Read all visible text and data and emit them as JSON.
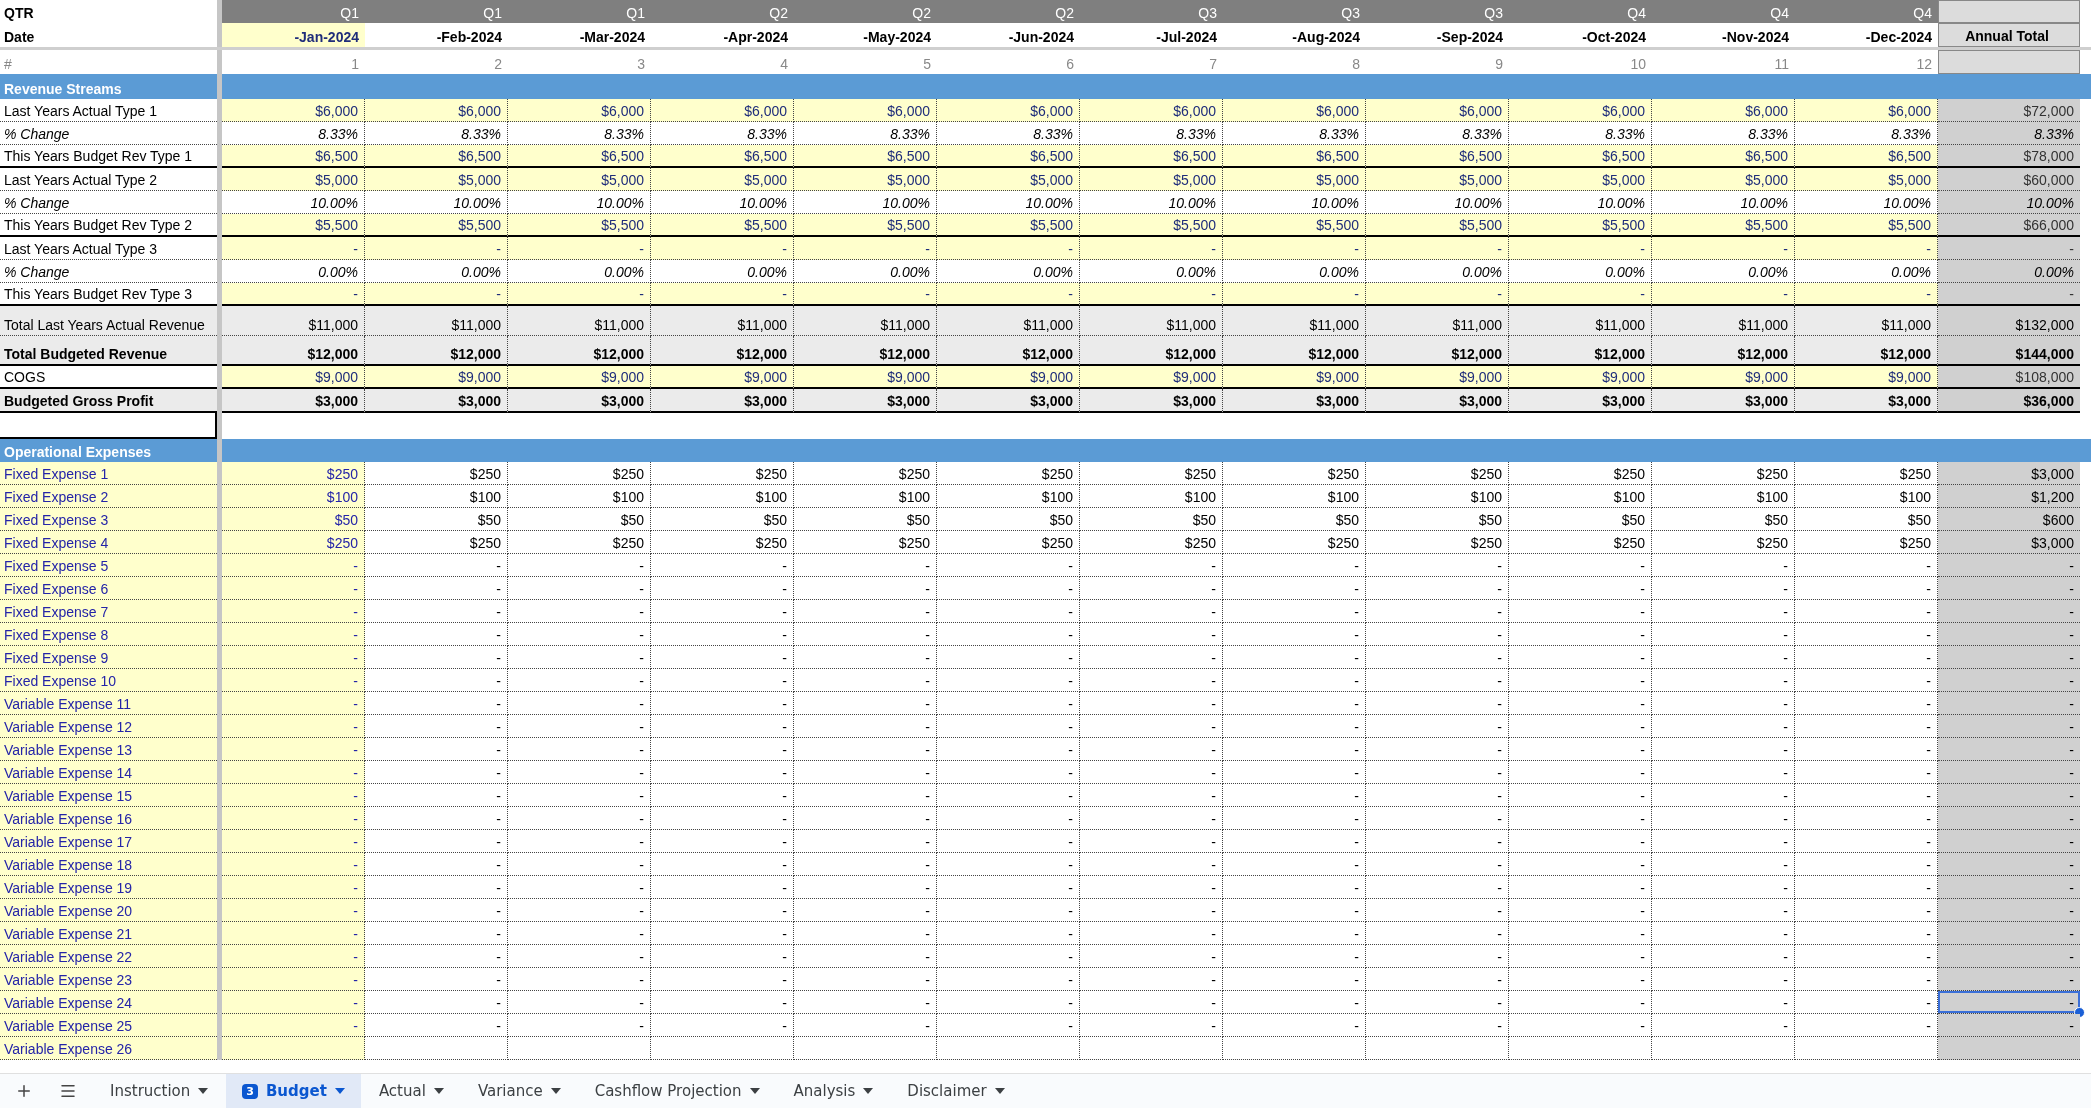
{
  "header": {
    "qtr_label": "QTR",
    "date_label": "Date",
    "number_label": "#",
    "annual_label": "Annual Total"
  },
  "months": [
    {
      "quarter": "Q1",
      "date": "-Jan-2024",
      "number": "1",
      "input": true
    },
    {
      "quarter": "Q1",
      "date": "-Feb-2024",
      "number": "2",
      "input": false
    },
    {
      "quarter": "Q1",
      "date": "-Mar-2024",
      "number": "3",
      "input": false
    },
    {
      "quarter": "Q2",
      "date": "-Apr-2024",
      "number": "4",
      "input": false
    },
    {
      "quarter": "Q2",
      "date": "-May-2024",
      "number": "5",
      "input": false
    },
    {
      "quarter": "Q2",
      "date": "-Jun-2024",
      "number": "6",
      "input": false
    },
    {
      "quarter": "Q3",
      "date": "-Jul-2024",
      "number": "7",
      "input": false
    },
    {
      "quarter": "Q3",
      "date": "-Aug-2024",
      "number": "8",
      "input": false
    },
    {
      "quarter": "Q3",
      "date": "-Sep-2024",
      "number": "9",
      "input": false
    },
    {
      "quarter": "Q4",
      "date": "-Oct-2024",
      "number": "10",
      "input": false
    },
    {
      "quarter": "Q4",
      "date": "-Nov-2024",
      "number": "11",
      "input": false
    },
    {
      "quarter": "Q4",
      "date": "-Dec-2024",
      "number": "12",
      "input": false
    }
  ],
  "revenue": {
    "title": "Revenue Streams",
    "rows": [
      {
        "kind": "input",
        "label": "Last Years Actual Type 1",
        "values": [
          "$6,000",
          "$6,000",
          "$6,000",
          "$6,000",
          "$6,000",
          "$6,000",
          "$6,000",
          "$6,000",
          "$6,000",
          "$6,000",
          "$6,000",
          "$6,000"
        ],
        "annual": "$72,000",
        "group_end": false
      },
      {
        "kind": "percent",
        "label": "% Change",
        "values": [
          "8.33%",
          "8.33%",
          "8.33%",
          "8.33%",
          "8.33%",
          "8.33%",
          "8.33%",
          "8.33%",
          "8.33%",
          "8.33%",
          "8.33%",
          "8.33%"
        ],
        "annual": "8.33%",
        "group_end": false
      },
      {
        "kind": "input",
        "label": "This Years Budget Rev Type 1",
        "values": [
          "$6,500",
          "$6,500",
          "$6,500",
          "$6,500",
          "$6,500",
          "$6,500",
          "$6,500",
          "$6,500",
          "$6,500",
          "$6,500",
          "$6,500",
          "$6,500"
        ],
        "annual": "$78,000",
        "group_end": true
      },
      {
        "kind": "input",
        "label": "Last Years Actual Type 2",
        "values": [
          "$5,000",
          "$5,000",
          "$5,000",
          "$5,000",
          "$5,000",
          "$5,000",
          "$5,000",
          "$5,000",
          "$5,000",
          "$5,000",
          "$5,000",
          "$5,000"
        ],
        "annual": "$60,000",
        "group_end": false
      },
      {
        "kind": "percent",
        "label": "% Change",
        "values": [
          "10.00%",
          "10.00%",
          "10.00%",
          "10.00%",
          "10.00%",
          "10.00%",
          "10.00%",
          "10.00%",
          "10.00%",
          "10.00%",
          "10.00%",
          "10.00%"
        ],
        "annual": "10.00%",
        "group_end": false
      },
      {
        "kind": "input",
        "label": "This Years Budget Rev Type 2",
        "values": [
          "$5,500",
          "$5,500",
          "$5,500",
          "$5,500",
          "$5,500",
          "$5,500",
          "$5,500",
          "$5,500",
          "$5,500",
          "$5,500",
          "$5,500",
          "$5,500"
        ],
        "annual": "$66,000",
        "group_end": true
      },
      {
        "kind": "input",
        "label": "Last Years Actual Type 3",
        "values": [
          "-",
          "-",
          "-",
          "-",
          "-",
          "-",
          "-",
          "-",
          "-",
          "-",
          "-",
          "-"
        ],
        "annual": "-",
        "group_end": false
      },
      {
        "kind": "percent",
        "label": "% Change",
        "values": [
          "0.00%",
          "0.00%",
          "0.00%",
          "0.00%",
          "0.00%",
          "0.00%",
          "0.00%",
          "0.00%",
          "0.00%",
          "0.00%",
          "0.00%",
          "0.00%"
        ],
        "annual": "0.00%",
        "group_end": false
      },
      {
        "kind": "input",
        "label": "This Years Budget Rev Type 3",
        "values": [
          "-",
          "-",
          "-",
          "-",
          "-",
          "-",
          "-",
          "-",
          "-",
          "-",
          "-",
          "-"
        ],
        "annual": "-",
        "group_end": true
      },
      {
        "kind": "total",
        "label": "Total Last Years Actual Revenue",
        "values": [
          "$11,000",
          "$11,000",
          "$11,000",
          "$11,000",
          "$11,000",
          "$11,000",
          "$11,000",
          "$11,000",
          "$11,000",
          "$11,000",
          "$11,000",
          "$11,000"
        ],
        "annual": "$132,000",
        "group_end": false
      },
      {
        "kind": "total_bold",
        "label": "Total Budgeted Revenue",
        "values": [
          "$12,000",
          "$12,000",
          "$12,000",
          "$12,000",
          "$12,000",
          "$12,000",
          "$12,000",
          "$12,000",
          "$12,000",
          "$12,000",
          "$12,000",
          "$12,000"
        ],
        "annual": "$144,000",
        "group_end": true
      },
      {
        "kind": "input",
        "label": "COGS",
        "values": [
          "$9,000",
          "$9,000",
          "$9,000",
          "$9,000",
          "$9,000",
          "$9,000",
          "$9,000",
          "$9,000",
          "$9,000",
          "$9,000",
          "$9,000",
          "$9,000"
        ],
        "annual": "$108,000",
        "group_end": true
      },
      {
        "kind": "profit",
        "label": "Budgeted Gross Profit",
        "values": [
          "$3,000",
          "$3,000",
          "$3,000",
          "$3,000",
          "$3,000",
          "$3,000",
          "$3,000",
          "$3,000",
          "$3,000",
          "$3,000",
          "$3,000",
          "$3,000"
        ],
        "annual": "$36,000",
        "group_end": true
      }
    ]
  },
  "expenses": {
    "title": "Operational Expenses",
    "rows": [
      {
        "label": "Fixed Expense 1",
        "values": [
          "$250",
          "$250",
          "$250",
          "$250",
          "$250",
          "$250",
          "$250",
          "$250",
          "$250",
          "$250",
          "$250",
          "$250"
        ],
        "annual": "$3,000",
        "selected": false
      },
      {
        "label": "Fixed Expense 2",
        "values": [
          "$100",
          "$100",
          "$100",
          "$100",
          "$100",
          "$100",
          "$100",
          "$100",
          "$100",
          "$100",
          "$100",
          "$100"
        ],
        "annual": "$1,200",
        "selected": false
      },
      {
        "label": "Fixed Expense 3",
        "values": [
          "$50",
          "$50",
          "$50",
          "$50",
          "$50",
          "$50",
          "$50",
          "$50",
          "$50",
          "$50",
          "$50",
          "$50"
        ],
        "annual": "$600",
        "selected": false
      },
      {
        "label": "Fixed Expense 4",
        "values": [
          "$250",
          "$250",
          "$250",
          "$250",
          "$250",
          "$250",
          "$250",
          "$250",
          "$250",
          "$250",
          "$250",
          "$250"
        ],
        "annual": "$3,000",
        "selected": false
      },
      {
        "label": "Fixed Expense 5",
        "values": [
          "-",
          "-",
          "-",
          "-",
          "-",
          "-",
          "-",
          "-",
          "-",
          "-",
          "-",
          "-"
        ],
        "annual": "-",
        "selected": false
      },
      {
        "label": "Fixed Expense 6",
        "values": [
          "-",
          "-",
          "-",
          "-",
          "-",
          "-",
          "-",
          "-",
          "-",
          "-",
          "-",
          "-"
        ],
        "annual": "-",
        "selected": false
      },
      {
        "label": "Fixed Expense 7",
        "values": [
          "-",
          "-",
          "-",
          "-",
          "-",
          "-",
          "-",
          "-",
          "-",
          "-",
          "-",
          "-"
        ],
        "annual": "-",
        "selected": false
      },
      {
        "label": "Fixed Expense 8",
        "values": [
          "-",
          "-",
          "-",
          "-",
          "-",
          "-",
          "-",
          "-",
          "-",
          "-",
          "-",
          "-"
        ],
        "annual": "-",
        "selected": false
      },
      {
        "label": "Fixed Expense 9",
        "values": [
          "-",
          "-",
          "-",
          "-",
          "-",
          "-",
          "-",
          "-",
          "-",
          "-",
          "-",
          "-"
        ],
        "annual": "-",
        "selected": false
      },
      {
        "label": "Fixed Expense 10",
        "values": [
          "-",
          "-",
          "-",
          "-",
          "-",
          "-",
          "-",
          "-",
          "-",
          "-",
          "-",
          "-"
        ],
        "annual": "-",
        "selected": false
      },
      {
        "label": "Variable Expense 11",
        "values": [
          "-",
          "-",
          "-",
          "-",
          "-",
          "-",
          "-",
          "-",
          "-",
          "-",
          "-",
          "-"
        ],
        "annual": "-",
        "selected": false
      },
      {
        "label": "Variable Expense 12",
        "values": [
          "-",
          "-",
          "-",
          "-",
          "-",
          "-",
          "-",
          "-",
          "-",
          "-",
          "-",
          "-"
        ],
        "annual": "-",
        "selected": false
      },
      {
        "label": "Variable Expense 13",
        "values": [
          "-",
          "-",
          "-",
          "-",
          "-",
          "-",
          "-",
          "-",
          "-",
          "-",
          "-",
          "-"
        ],
        "annual": "-",
        "selected": false
      },
      {
        "label": "Variable Expense 14",
        "values": [
          "-",
          "-",
          "-",
          "-",
          "-",
          "-",
          "-",
          "-",
          "-",
          "-",
          "-",
          "-"
        ],
        "annual": "-",
        "selected": false
      },
      {
        "label": "Variable Expense 15",
        "values": [
          "-",
          "-",
          "-",
          "-",
          "-",
          "-",
          "-",
          "-",
          "-",
          "-",
          "-",
          "-"
        ],
        "annual": "-",
        "selected": false
      },
      {
        "label": "Variable Expense 16",
        "values": [
          "-",
          "-",
          "-",
          "-",
          "-",
          "-",
          "-",
          "-",
          "-",
          "-",
          "-",
          "-"
        ],
        "annual": "-",
        "selected": false
      },
      {
        "label": "Variable Expense 17",
        "values": [
          "-",
          "-",
          "-",
          "-",
          "-",
          "-",
          "-",
          "-",
          "-",
          "-",
          "-",
          "-"
        ],
        "annual": "-",
        "selected": false
      },
      {
        "label": "Variable Expense 18",
        "values": [
          "-",
          "-",
          "-",
          "-",
          "-",
          "-",
          "-",
          "-",
          "-",
          "-",
          "-",
          "-"
        ],
        "annual": "-",
        "selected": false
      },
      {
        "label": "Variable Expense 19",
        "values": [
          "-",
          "-",
          "-",
          "-",
          "-",
          "-",
          "-",
          "-",
          "-",
          "-",
          "-",
          "-"
        ],
        "annual": "-",
        "selected": false
      },
      {
        "label": "Variable Expense 20",
        "values": [
          "-",
          "-",
          "-",
          "-",
          "-",
          "-",
          "-",
          "-",
          "-",
          "-",
          "-",
          "-"
        ],
        "annual": "-",
        "selected": false
      },
      {
        "label": "Variable Expense 21",
        "values": [
          "-",
          "-",
          "-",
          "-",
          "-",
          "-",
          "-",
          "-",
          "-",
          "-",
          "-",
          "-"
        ],
        "annual": "-",
        "selected": false
      },
      {
        "label": "Variable Expense 22",
        "values": [
          "-",
          "-",
          "-",
          "-",
          "-",
          "-",
          "-",
          "-",
          "-",
          "-",
          "-",
          "-"
        ],
        "annual": "-",
        "selected": false
      },
      {
        "label": "Variable Expense 23",
        "values": [
          "-",
          "-",
          "-",
          "-",
          "-",
          "-",
          "-",
          "-",
          "-",
          "-",
          "-",
          "-"
        ],
        "annual": "-",
        "selected": false
      },
      {
        "label": "Variable Expense 24",
        "values": [
          "-",
          "-",
          "-",
          "-",
          "-",
          "-",
          "-",
          "-",
          "-",
          "-",
          "-",
          "-"
        ],
        "annual": "-",
        "selected": true
      },
      {
        "label": "Variable Expense 25",
        "values": [
          "-",
          "-",
          "-",
          "-",
          "-",
          "-",
          "-",
          "-",
          "-",
          "-",
          "-",
          "-"
        ],
        "annual": "-",
        "selected": false
      },
      {
        "label": "Variable Expense 26",
        "values": [],
        "annual": "",
        "selected": false
      }
    ]
  },
  "sheet_tabs": [
    {
      "label": "Instruction",
      "selected": false
    },
    {
      "label": "Budget",
      "selected": true,
      "badge": "3"
    },
    {
      "label": "Actual",
      "selected": false
    },
    {
      "label": "Variance",
      "selected": false
    },
    {
      "label": "Cashflow Projection",
      "selected": false
    },
    {
      "label": "Analysis",
      "selected": false
    },
    {
      "label": "Disclaimer",
      "selected": false
    }
  ]
}
